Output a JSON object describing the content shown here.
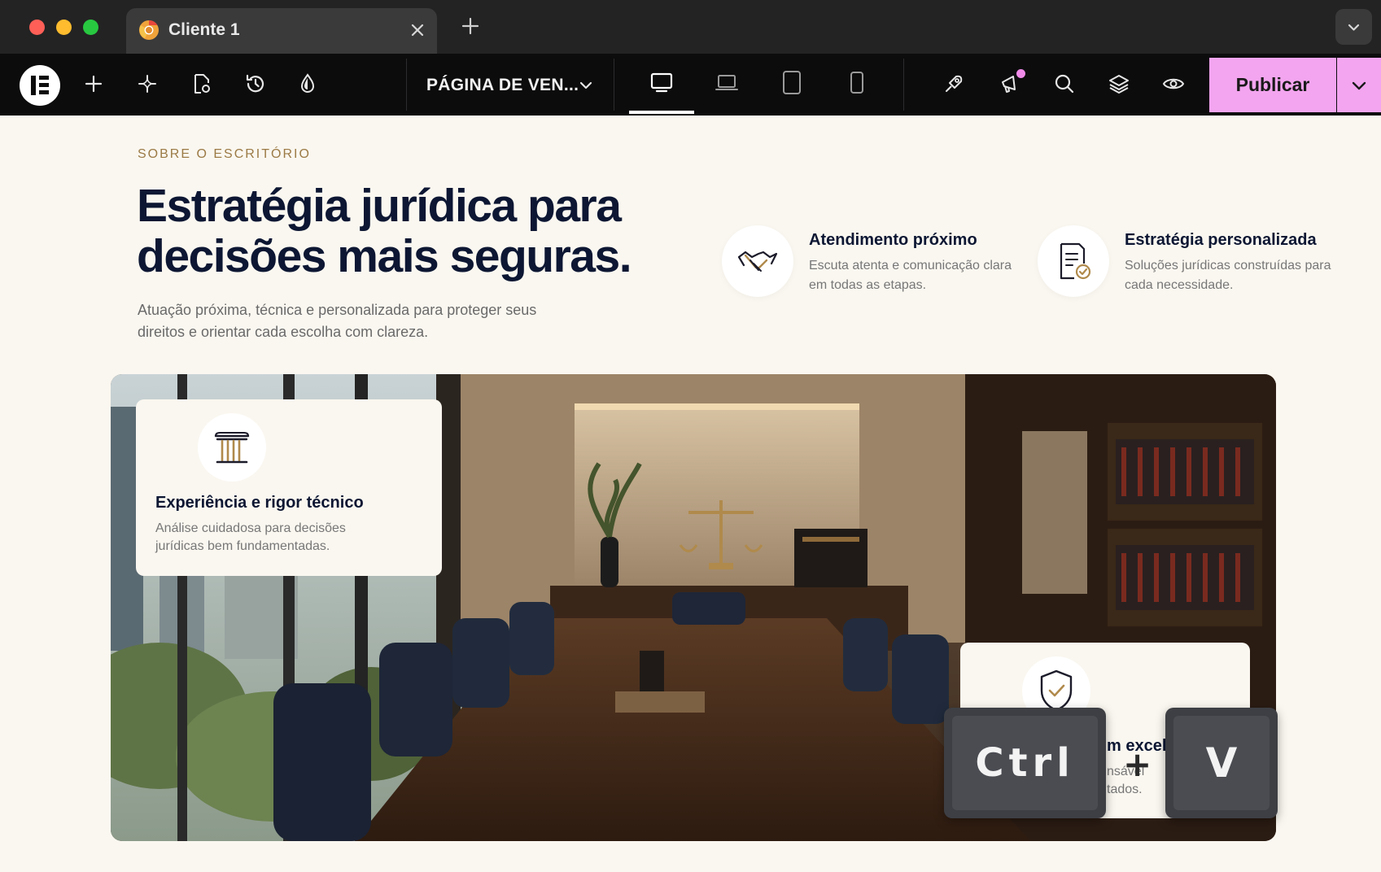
{
  "browser": {
    "tab_title": "Cliente 1"
  },
  "toolbar": {
    "page_name": "PÁGINA DE VEN...",
    "publish_label": "Publicar"
  },
  "section": {
    "eyebrow": "SOBRE O ESCRITÓRIO",
    "headline": "Estratégia jurídica para decisões mais seguras.",
    "lead": "Atuação próxima, técnica e personalizada para proteger seus direitos e orientar cada escolha com clareza."
  },
  "features": [
    {
      "icon": "handshake-icon",
      "title": "Atendimento próximo",
      "desc": "Escuta atenta e comunicação clara em todas as etapas."
    },
    {
      "icon": "document-check-icon",
      "title": "Estratégia personalizada",
      "desc": "Soluções jurídicas construídas para cada necessidade."
    }
  ],
  "cards": [
    {
      "icon": "column-icon",
      "title": "Experiência e rigor técnico",
      "desc": "Análise cuidadosa para decisões jurídicas bem fundamentadas."
    },
    {
      "icon": "shield-check-icon",
      "title_fragment": "m excel",
      "desc_fragment_1": "nsável",
      "desc_fragment_2": "tados."
    }
  ],
  "keys": {
    "ctrl": "Ctrl",
    "plus": "+",
    "v": "V"
  },
  "colors": {
    "accent_publish": "#f3a5ef",
    "heading_navy": "#0d1733",
    "eyebrow_gold": "#9b7a45",
    "page_bg": "#faf7f0"
  }
}
